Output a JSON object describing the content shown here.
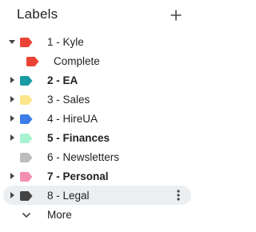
{
  "header": {
    "title": "Labels",
    "add_icon": "plus-icon"
  },
  "labels": [
    {
      "name": "1 - Kyle",
      "color": "#ea4335",
      "bold": false,
      "expander": "down",
      "indent": 0
    },
    {
      "name": "Complete",
      "color": "#ea4335",
      "bold": false,
      "expander": "none",
      "indent": 1
    },
    {
      "name": "2 - EA",
      "color": "#1a9aa3",
      "bold": true,
      "expander": "right",
      "indent": 0
    },
    {
      "name": "3 - Sales",
      "color": "#fde68a",
      "bold": false,
      "expander": "right",
      "indent": 0
    },
    {
      "name": "4 - HireUA",
      "color": "#3b7de6",
      "bold": false,
      "expander": "right",
      "indent": 0
    },
    {
      "name": "5 - Finances",
      "color": "#a7f3d0",
      "bold": true,
      "expander": "right",
      "indent": 0
    },
    {
      "name": "6 - Newsletters",
      "color": "#bdbdbd",
      "bold": false,
      "expander": "none",
      "indent": 0
    },
    {
      "name": "7 - Personal",
      "color": "#f48fb1",
      "bold": true,
      "expander": "right",
      "indent": 0
    },
    {
      "name": "8 - Legal",
      "color": "#424242",
      "bold": false,
      "expander": "right",
      "indent": 0,
      "hovered": true
    }
  ],
  "more": {
    "label": "More",
    "icon": "chevron-down-icon"
  },
  "colors": {
    "text": "#202124",
    "icon": "#444746",
    "hover_bg": "#eceff1"
  }
}
